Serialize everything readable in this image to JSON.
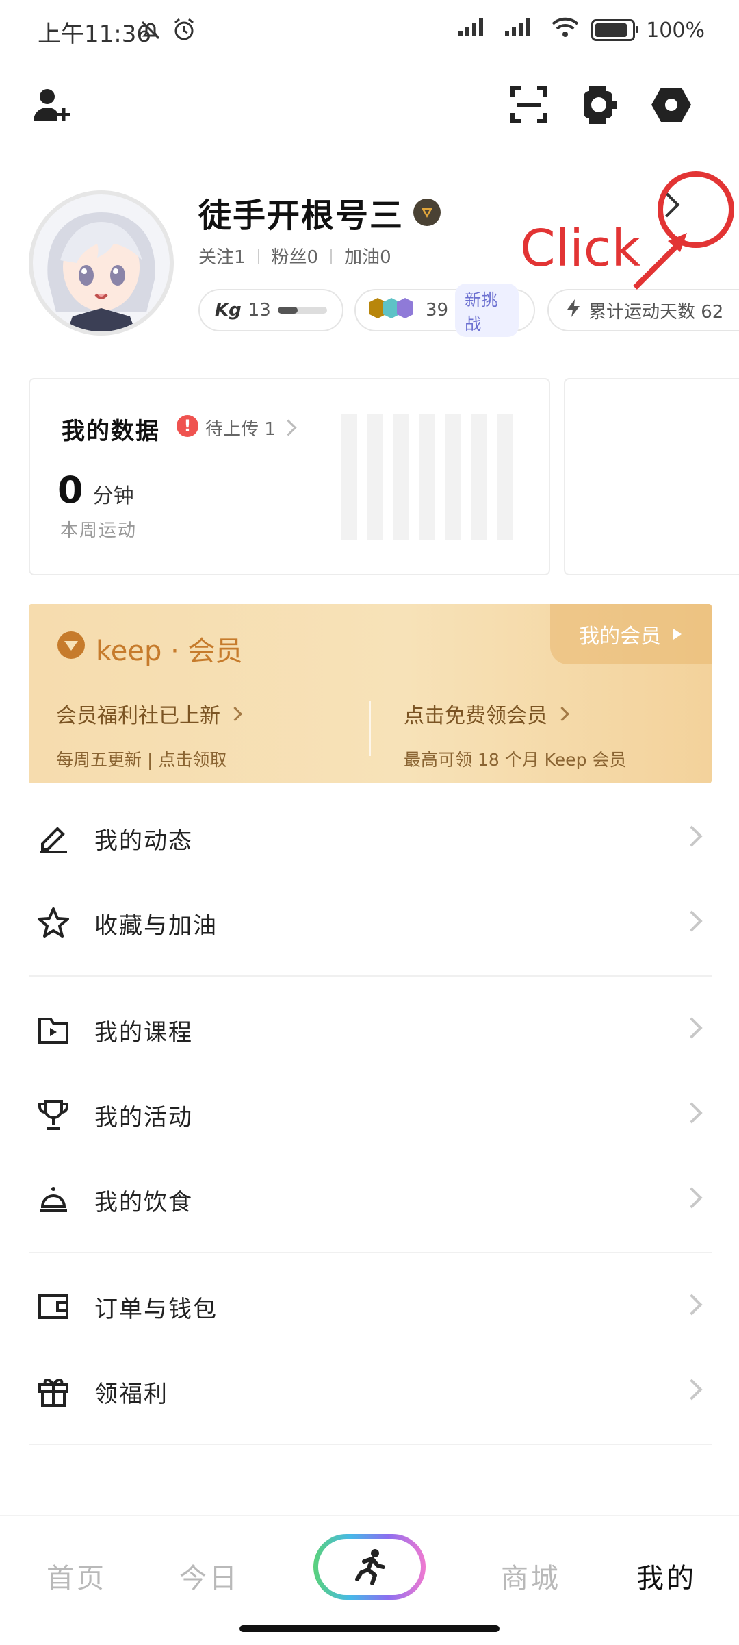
{
  "status_bar": {
    "time": "上午11:36",
    "battery": "100%",
    "battery_level": 1.0
  },
  "profile": {
    "username": "徒手开根号三",
    "following": "关注1",
    "followers": "粉丝0",
    "cheers": "加油0",
    "level_label": "13",
    "level_progress": 0.4,
    "medals_count": "39",
    "challenge_label": "新挑战",
    "accumulated_days": "累计运动天数 62"
  },
  "annotation": {
    "text": "Click",
    "color": "#e23434"
  },
  "my_data": {
    "title": "我的数据",
    "pending": "待上传 1",
    "minutes_value": "0",
    "minutes_unit": "分钟",
    "subtitle": "本周运动"
  },
  "member": {
    "brand": "keep · 会员",
    "my_member": "我的会员",
    "left_title": "会员福利社已上新",
    "left_sub": "每周五更新 | 点击领取",
    "right_title": "点击免费领会员",
    "right_sub": "最高可领 18 个月 Keep 会员",
    "accent_color": "#c67b2c"
  },
  "menu": [
    {
      "label": "我的动态",
      "icon": "pencil-icon"
    },
    {
      "label": "收藏与加油",
      "icon": "star-icon"
    },
    {
      "label": "我的课程",
      "icon": "play-icon"
    },
    {
      "label": "我的活动",
      "icon": "trophy-icon"
    },
    {
      "label": "我的饮食",
      "icon": "cloche-icon"
    },
    {
      "label": "订单与钱包",
      "icon": "wallet-icon"
    },
    {
      "label": "领福利",
      "icon": "gift-icon"
    }
  ],
  "bottom_nav": {
    "home": "首页",
    "today": "今日",
    "store": "商城",
    "mine": "我的",
    "active": "我的"
  }
}
